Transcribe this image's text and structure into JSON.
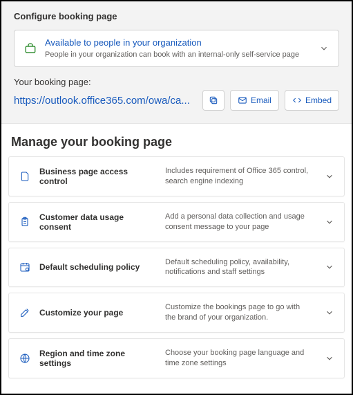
{
  "configure": {
    "title": "Configure booking page",
    "availability": {
      "title": "Available to people in your organization",
      "subtitle": "People in your organization can book with an internal-only self-service page"
    },
    "url_label": "Your booking page:",
    "url": "https://outlook.office365.com/owa/ca...",
    "email_label": "Email",
    "embed_label": "Embed"
  },
  "manage": {
    "title": "Manage your booking page",
    "sections": [
      {
        "icon": "page-lock",
        "title": "Business page access control",
        "desc": "Includes requirement of Office 365 control, search engine indexing"
      },
      {
        "icon": "clipboard",
        "title": "Customer data usage consent",
        "desc": "Add a personal data collection and usage consent message to your page"
      },
      {
        "icon": "calendar-gear",
        "title": "Default scheduling policy",
        "desc": "Default scheduling policy, availability, notifications and staff settings"
      },
      {
        "icon": "paint",
        "title": "Customize your page",
        "desc": "Customize the bookings page to go with the brand of your organization."
      },
      {
        "icon": "globe",
        "title": "Region and time zone settings",
        "desc": "Choose your booking page language and time zone settings"
      }
    ]
  },
  "colors": {
    "accent": "#185abd",
    "iconGreen": "#107c10"
  }
}
